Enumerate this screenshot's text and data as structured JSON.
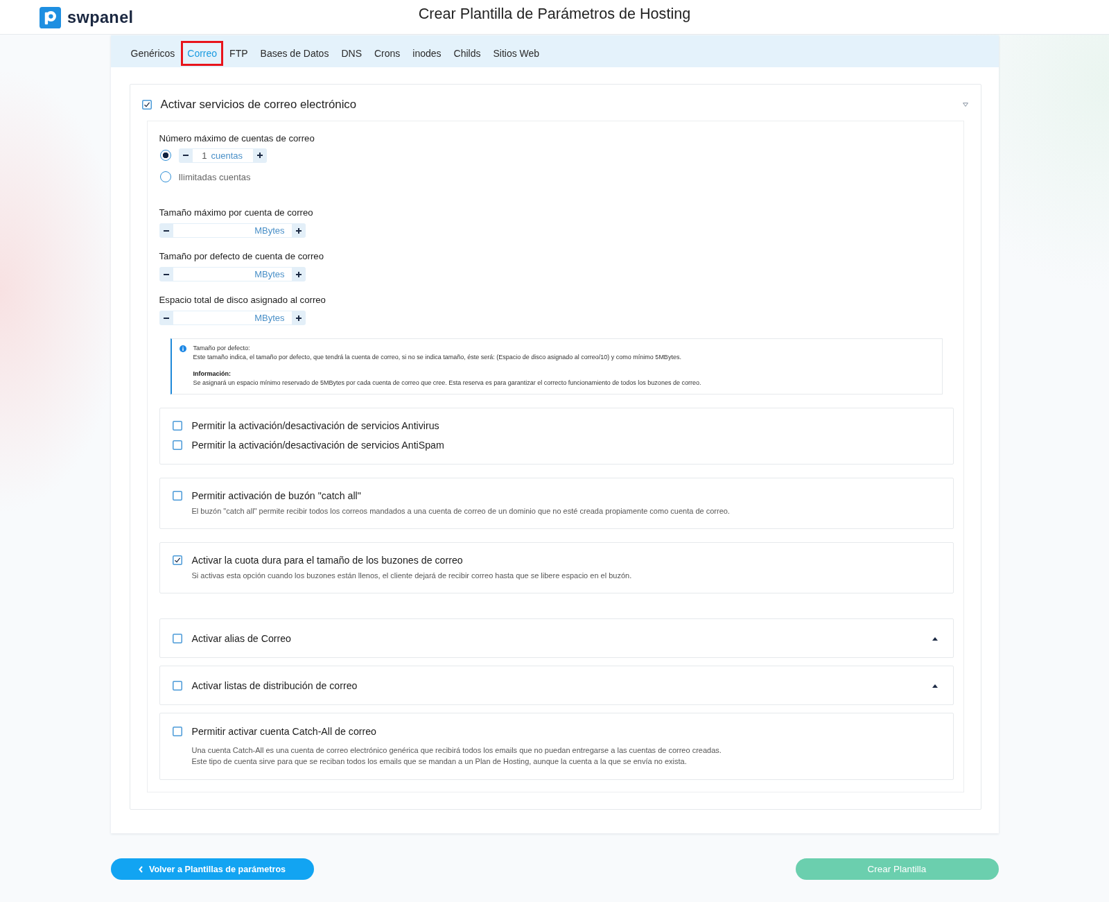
{
  "header": {
    "logo_text": "swpanel",
    "title": "Crear Plantilla de Parámetros de Hosting"
  },
  "tabs": [
    {
      "label": "Genéricos",
      "selected": false,
      "highlighted": false
    },
    {
      "label": "Correo",
      "selected": true,
      "highlighted": true
    },
    {
      "label": "FTP",
      "selected": false,
      "highlighted": false
    },
    {
      "label": "Bases de Datos",
      "selected": false,
      "highlighted": false
    },
    {
      "label": "DNS",
      "selected": false,
      "highlighted": false
    },
    {
      "label": "Crons",
      "selected": false,
      "highlighted": false
    },
    {
      "label": "inodes",
      "selected": false,
      "highlighted": false
    },
    {
      "label": "Childs",
      "selected": false,
      "highlighted": false
    },
    {
      "label": "Sitios Web",
      "selected": false,
      "highlighted": false
    }
  ],
  "email_section": {
    "label": "Activar servicios de correo electrónico",
    "checked": true,
    "max_accounts": {
      "label": "Número máximo de cuentas de correo",
      "options": [
        {
          "kind": "stepper",
          "selected": true,
          "value": "1",
          "unit": "cuentas"
        },
        {
          "kind": "text",
          "selected": false,
          "label": "Ilimitadas cuentas"
        }
      ]
    },
    "size_fields": [
      {
        "label": "Tamaño máximo por cuenta de correo",
        "unit": "MBytes"
      },
      {
        "label": "Tamaño por defecto de cuenta de correo",
        "unit": "MBytes"
      },
      {
        "label": "Espacio total de disco asignado al correo",
        "unit": "MBytes"
      }
    ],
    "info_box": {
      "blocks": [
        {
          "title": "Tamaño por defecto:",
          "bold_title": false,
          "text": "Este tamaño indica, el tamaño por defecto, que tendrá la cuenta de correo, si no se indica tamaño, éste será: (Espacio de disco asignado al correo/10) y como mínimo 5MBytes."
        },
        {
          "title": "Información:",
          "bold_title": true,
          "text": "Se asignará un espacio mínimo reservado de 5MBytes por cada cuenta de correo que cree. Esta reserva es para garantizar el correcto funcionamiento de todos los buzones de correo."
        }
      ]
    },
    "option_cards": [
      {
        "options": [
          {
            "label": "Permitir la activación/desactivación de servicios Antivirus",
            "checked": false
          },
          {
            "label": "Permitir la activación/desactivación de servicios AntiSpam",
            "checked": false
          }
        ]
      },
      {
        "options": [
          {
            "label": "Permitir activación de buzón \"catch all\"",
            "checked": false,
            "description_lines": [
              "El buzón \"catch all\" permite recibir todos los correos mandados a una cuenta de correo de un dominio que no esté creada propiamente como cuenta de correo."
            ]
          }
        ]
      },
      {
        "options": [
          {
            "label": "Activar la cuota dura para el tamaño de los buzones de correo",
            "checked": true,
            "description_lines": [
              "Si activas esta opción cuando los buzones están llenos, el cliente dejará de recibir correo hasta que se libere espacio en el buzón."
            ]
          }
        ]
      }
    ],
    "extra_cards": [
      {
        "kind": "accordion",
        "options": [
          {
            "label": "Activar alias de Correo",
            "checked": false
          }
        ]
      },
      {
        "kind": "accordion",
        "options": [
          {
            "label": "Activar listas de distribución de correo",
            "checked": false
          }
        ]
      },
      {
        "kind": "plain",
        "options": [
          {
            "label": "Permitir activar cuenta Catch-All de correo",
            "checked": false,
            "description_lines": [
              "Una cuenta Catch-All es una cuenta de correo electrónico genérica que recibirá todos los emails que no puedan entregarse a las cuentas de correo creadas.",
              "Este tipo de cuenta sirve para que se reciban todos los emails que se mandan a un Plan de Hosting, aunque la cuenta a la que se envía no exista."
            ]
          }
        ]
      }
    ]
  },
  "footer": {
    "back_button": "Volver a Plantillas de parámetros",
    "create_button": "Crear Plantilla"
  }
}
